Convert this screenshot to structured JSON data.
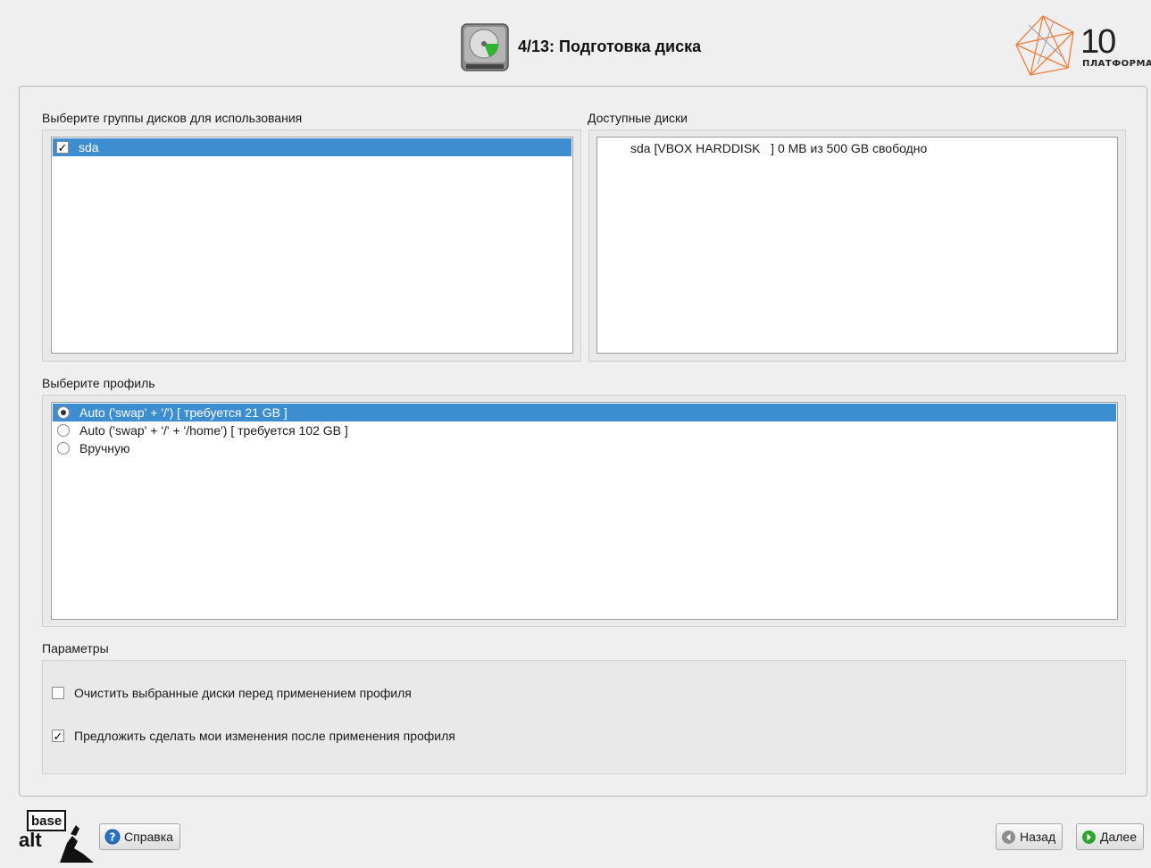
{
  "header": {
    "title": "4/13: Подготовка диска",
    "brand_number": "10",
    "brand_subtitle": "ПЛАТФОРМА"
  },
  "disk_groups": {
    "label": "Выберите группы дисков для использования",
    "items": [
      {
        "name": "sda",
        "checked": true,
        "selected": true
      }
    ]
  },
  "available_disks": {
    "label": "Доступные диски",
    "items": [
      {
        "text": "sda [VBOX HARDDISK   ] 0 MB из 500 GB свободно"
      }
    ]
  },
  "profile": {
    "label": "Выберите профиль",
    "options": [
      {
        "label": "Auto ('swap' + '/') [ требуется 21 GB ]",
        "checked": true,
        "selected": true
      },
      {
        "label": "Auto ('swap' + '/' + '/home') [ требуется 102 GB ]",
        "checked": false,
        "selected": false
      },
      {
        "label": "Вручную",
        "checked": false,
        "selected": false
      }
    ]
  },
  "parameters": {
    "label": "Параметры",
    "options": [
      {
        "label": "Очистить выбранные диски перед применением профиля",
        "checked": false
      },
      {
        "label": "Предложить сделать мои изменения после применения профиля",
        "checked": true
      }
    ]
  },
  "footer": {
    "logo_top": "base",
    "logo_bottom": "alt",
    "help_label": "Справка",
    "back_label": "Назад",
    "next_label": "Далее"
  },
  "colors": {
    "selection": "#3c8ed1",
    "background": "#efefef",
    "brand_orange": "#f07d3e"
  }
}
